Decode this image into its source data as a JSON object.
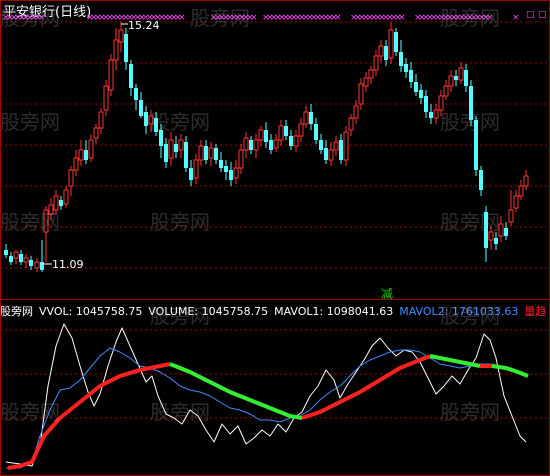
{
  "chart_title": "平安银行(日线)",
  "price_annotations": {
    "high_label": "15.24",
    "low_label": "11.09",
    "signal_label": "减"
  },
  "volume_panel": {
    "label": "股旁网",
    "vvol": "VVOL: 1045758.75",
    "volume": "VOLUME: 1045758.75",
    "mavol1": "MAVOL1: 1098041.63",
    "mavol2": "MAVOL2: 1761033.63",
    "trend": "量趋"
  },
  "watermark": "股旁网",
  "colors": {
    "background": "#000000",
    "up_candle": "#ff3232",
    "down_candle": "#54ffff",
    "grid": "#a00000",
    "vvol_line": "#ffffff",
    "volume_line": "#3c8cff",
    "trend_rising": "#ff2020",
    "trend_falling": "#33ee33",
    "markers": "#ff44ff"
  },
  "chart_data": [
    {
      "type": "candlestick",
      "title": "平安银行(日线)",
      "annotations": [
        "15.24",
        "11.09",
        "减"
      ],
      "ohlc_up_down": "rising candles red, falling candles cyan"
    },
    {
      "type": "line",
      "series": [
        {
          "name": "VVOL",
          "last": 1045758.75
        },
        {
          "name": "VOLUME",
          "last": 1045758.75
        },
        {
          "name": "MAVOL1",
          "last": 1098041.63
        },
        {
          "name": "MAVOL2",
          "last": 1761033.63
        }
      ]
    }
  ]
}
